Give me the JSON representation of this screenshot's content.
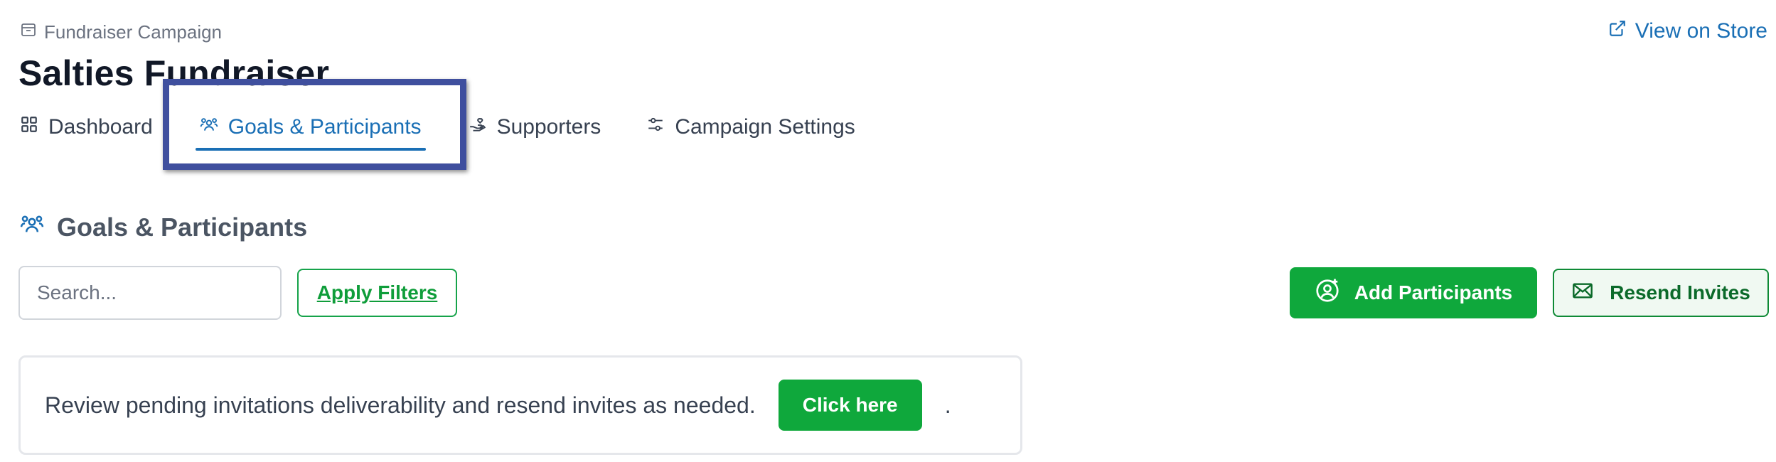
{
  "header": {
    "eyebrow": "Fundraiser Campaign",
    "title": "Salties Fundraiser",
    "view_store": "View on Store"
  },
  "tabs": [
    {
      "label": "Dashboard",
      "icon": "grid-icon",
      "active": false
    },
    {
      "label": "Goals & Participants",
      "icon": "users-icon",
      "active": true
    },
    {
      "label": "Supporters",
      "icon": "hand-heart-icon",
      "active": false
    },
    {
      "label": "Campaign Settings",
      "icon": "sliders-icon",
      "active": false
    }
  ],
  "section": {
    "title": "Goals & Participants",
    "search_placeholder": "Search...",
    "apply_filters": "Apply Filters",
    "add_participants": "Add Participants",
    "resend_invites": "Resend Invites"
  },
  "notice": {
    "text": "Review pending invitations deliverability and resend invites as needed.",
    "button": "Click here",
    "trailing": "."
  },
  "colors": {
    "accent_blue": "#1a6fb5",
    "primary_green": "#0fa83c",
    "highlight_frame": "#3f4f9e"
  }
}
